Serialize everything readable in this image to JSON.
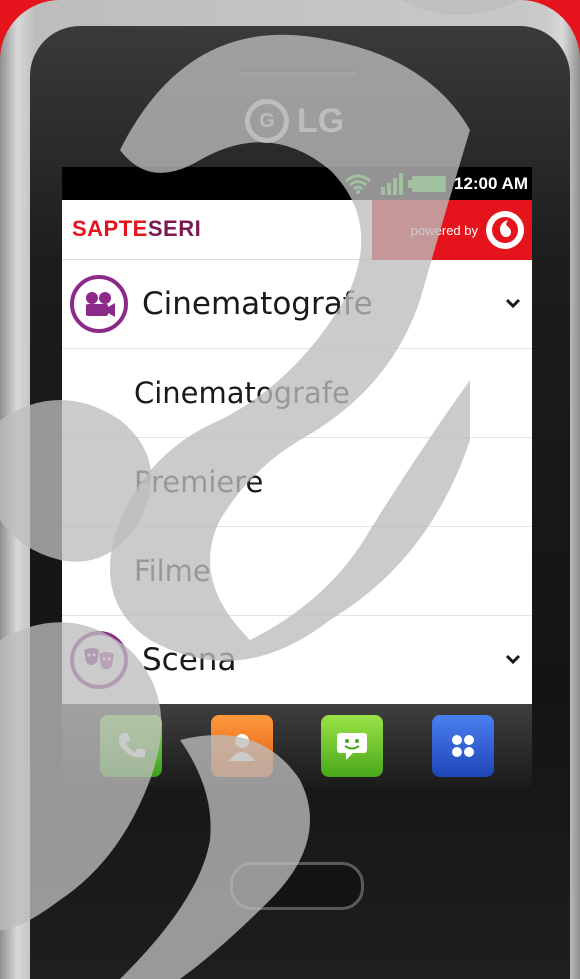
{
  "device": {
    "brand": "LG",
    "brand_logo_glyph": "G"
  },
  "status_bar": {
    "time": "12:00 AM",
    "icons": [
      "wifi-icon",
      "signal-icon",
      "battery-icon"
    ]
  },
  "header": {
    "logo_part_a": "SAPTE",
    "logo_part_b": "SERI",
    "powered_by": "powered by",
    "sponsor_logo": "vodafone-logo"
  },
  "menu": {
    "category_1": {
      "label": "Cinematografe",
      "icon": "film-camera-icon"
    },
    "items": [
      {
        "label": "Cinematografe"
      },
      {
        "label": "Premiere"
      },
      {
        "label": "Filme"
      }
    ],
    "category_2": {
      "label": "Scena",
      "icon": "theater-masks-icon"
    }
  },
  "dock": {
    "apps": [
      "phone-app",
      "contacts-app",
      "messaging-app",
      "apps-app"
    ]
  },
  "colors": {
    "background": "#e5141c",
    "accent_purple": "#8b2a88",
    "logo_red": "#e5141c",
    "logo_purple": "#7a1850"
  }
}
